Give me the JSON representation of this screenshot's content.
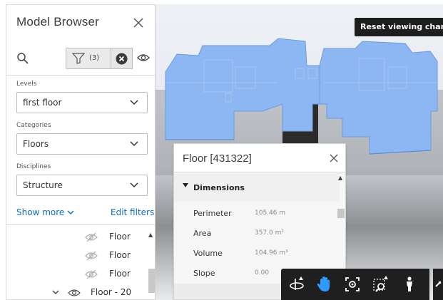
{
  "model_browser": {
    "title": "Model Browser",
    "filter_count": "(3)",
    "filters": [
      {
        "label": "Levels",
        "value": "first floor"
      },
      {
        "label": "Categories",
        "value": "Floors"
      },
      {
        "label": "Disciplines",
        "value": "Structure"
      }
    ],
    "show_more": "Show more",
    "edit_filters": "Edit filters",
    "tree": [
      {
        "label": "Floor"
      },
      {
        "label": "Floor"
      },
      {
        "label": "Floor"
      },
      {
        "label": "Floor - 20"
      }
    ]
  },
  "viewport": {
    "reset_button": "Reset viewing changes"
  },
  "properties": {
    "title": "Floor [431322]",
    "section": "Dimensions",
    "rows": [
      {
        "key": "Perimeter",
        "value": "105.46 m"
      },
      {
        "key": "Area",
        "value": "357.0 m²"
      },
      {
        "key": "Volume",
        "value": "104.96 m³"
      },
      {
        "key": "Slope",
        "value": "0.00"
      }
    ]
  },
  "toolbar": {
    "buttons": [
      "orbit-icon",
      "pan-icon",
      "focus-icon",
      "zoom-window-icon",
      "first-person-icon"
    ],
    "active": "pan-icon",
    "colors": {
      "background": "#1f1f1f",
      "active_icon": "#2e9cff",
      "icon": "#ffffff"
    }
  }
}
